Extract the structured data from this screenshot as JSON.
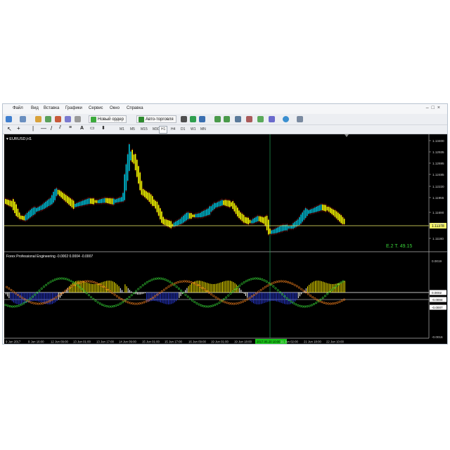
{
  "menu": [
    "Файл",
    "Вид",
    "Вставка",
    "Графики",
    "Сервис",
    "Окно",
    "Справка"
  ],
  "toolbar": {
    "new_order_label": "Новый ордер",
    "autotrading_label": "Авто-торговля"
  },
  "timeframes": [
    "M1",
    "M5",
    "M15",
    "M30",
    "H1",
    "H4",
    "D1",
    "W1",
    "MN"
  ],
  "active_timeframe": "H1",
  "chart": {
    "symbol_label": "EURUSD,H1",
    "indicator_label": "Forex Professional Engineering -0.0002 0.0004 -0.0007",
    "readout": "E.2  T. 49.15",
    "price_axis": [
      "1.13400",
      "1.12935",
      "1.12695",
      "1.12485",
      "1.12220",
      "1.11955",
      "1.11690",
      "1.11425",
      "1.11160"
    ],
    "current_price": "1.11378",
    "indicator_axis": [
      "0.0019",
      "0.0002",
      "-0.0004",
      "-0.0007",
      "-0.0016"
    ],
    "time_axis": [
      "9 Jun 2017",
      "9 Jun 16:00",
      "12 Jun 09:00",
      "13 Jun 01:00",
      "13 Jun 17:00",
      "14 Jun 09:00",
      "15 Jun 01:00",
      "15 Jun 17:00",
      "16 Jun 09:00",
      "19 Jun 01:00",
      "19 Jun 18:00",
      "2017.06.20 10:00",
      "21 Jun 02:00",
      "21 Jun 18:00",
      "22 Jun 10:00"
    ],
    "highlighted_time": "2017.06.20 10:00"
  },
  "colors": {
    "background": "#000000",
    "bull_candle": "#00bcd4",
    "bear_candle": "#ffff00",
    "wick_red": "#d01010",
    "price_line": "#f3f36a",
    "signal_line_green": "#33cc33",
    "signal_line_orange": "#e87a1a",
    "histo_white": "#ffffff",
    "histo_yellow": "#ffee00",
    "histo_blue": "#2a3bdc",
    "crosshair": "#1f8f4a",
    "time_highlight": "#16c216"
  }
}
